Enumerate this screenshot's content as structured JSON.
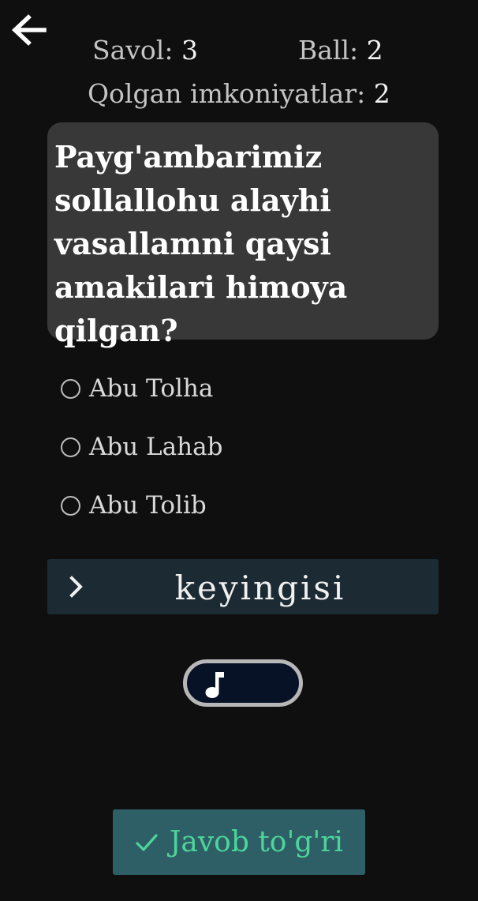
{
  "header": {
    "back_icon": "arrow-left-icon",
    "question_label": "Savol:",
    "question_number": "3",
    "score_label": "Ball:",
    "score_value": "2",
    "attempts_label": "Qolgan imkoniyatlar:",
    "attempts_value": "2"
  },
  "question": {
    "text": "Payg'ambarimiz sollallohu alayhi vasallamni qaysi amakilari himoya qilgan?"
  },
  "options": [
    {
      "label": "Abu Tolha",
      "selected": false
    },
    {
      "label": "Abu Lahab",
      "selected": false
    },
    {
      "label": "Abu Tolib",
      "selected": false
    }
  ],
  "next_button": {
    "label": "keyingisi",
    "icon": "chevron-right-icon"
  },
  "music_toggle": {
    "icon": "music-note-icon",
    "on": false
  },
  "result": {
    "icon": "checkmark-icon",
    "label": "Javob to'g'ri",
    "color": "#4cd59b"
  },
  "colors": {
    "background": "#0f0f0f",
    "card": "#383838",
    "next_button_bg": "#1b2a33",
    "result_bg": "#2f5f66",
    "toggle_bg": "#081227"
  }
}
